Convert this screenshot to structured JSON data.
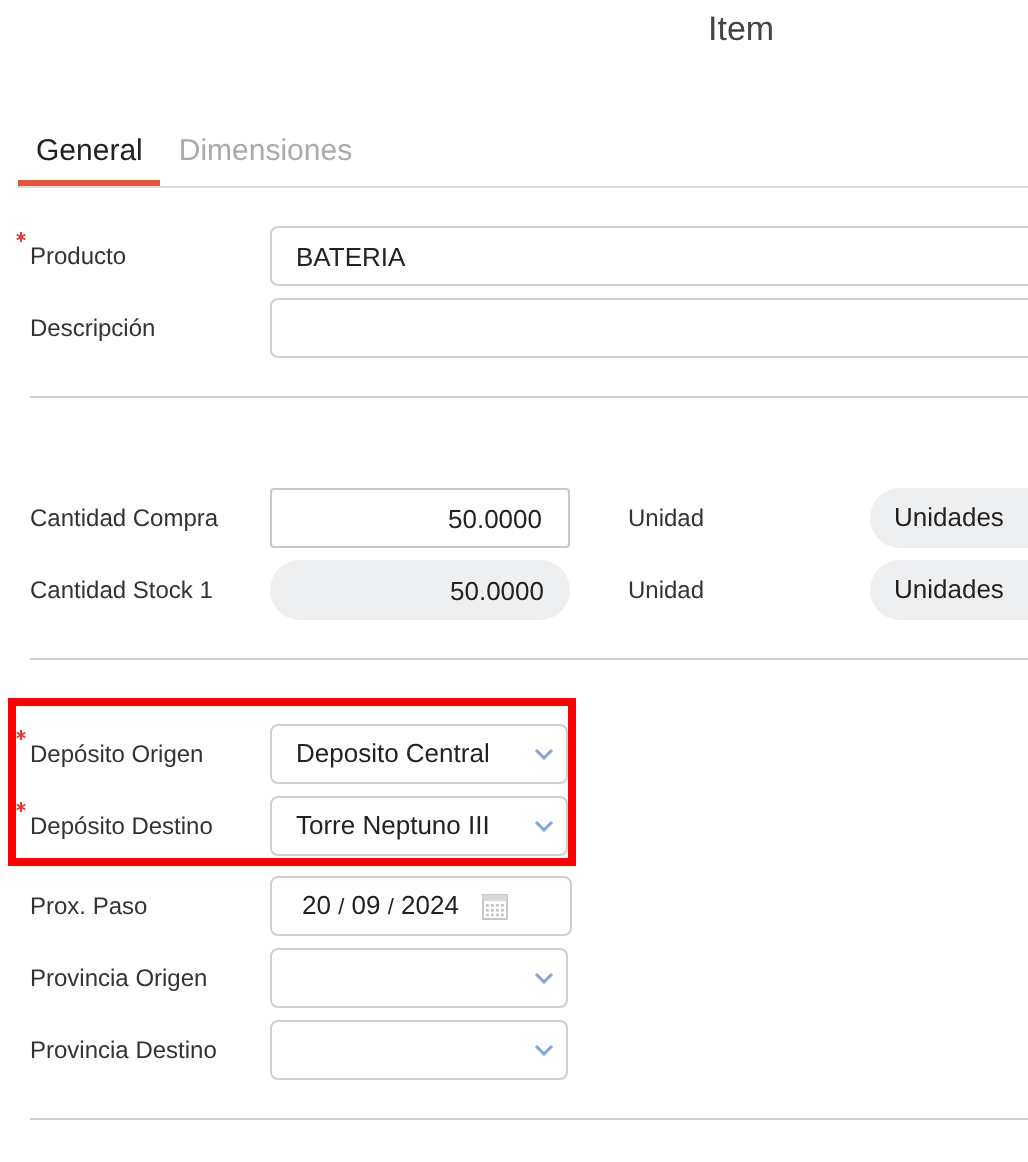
{
  "title": "Item",
  "tabs": [
    {
      "label": "General",
      "selected": true
    },
    {
      "label": "Dimensiones",
      "selected": false
    }
  ],
  "sections": [
    {
      "rows": [
        {
          "kind": "text",
          "label": "Producto",
          "required": true,
          "value": "BATERIA"
        },
        {
          "kind": "text",
          "label": "Descripción",
          "required": false
        }
      ]
    },
    {
      "rows": [
        {
          "kind": "quantity",
          "label": "Cantidad Compra",
          "required": false,
          "value": "50.0000",
          "readonly": false,
          "unit_label": "Unidad",
          "unit": "Unidades"
        },
        {
          "kind": "quantity",
          "label": "Cantidad Stock 1",
          "required": false,
          "value": "50.0000",
          "readonly": true,
          "unit_label": "Unidad",
          "unit": "Unidades"
        }
      ]
    },
    {
      "rows": [
        {
          "kind": "select",
          "label": "Depósito Origen",
          "required": true,
          "highlighted": true,
          "value": "Deposito Central"
        },
        {
          "kind": "select",
          "label": "Depósito Destino",
          "required": true,
          "highlighted": true,
          "value": "Torre Neptuno III"
        },
        {
          "kind": "date",
          "label": "Prox. Paso",
          "required": false,
          "highlighted": false,
          "day": "20",
          "month": "09",
          "year": "2024",
          "separator": "/"
        },
        {
          "kind": "select",
          "label": "Provincia Origen",
          "required": false,
          "highlighted": false
        },
        {
          "kind": "select",
          "label": "Provincia Destino",
          "required": false,
          "highlighted": false
        }
      ]
    }
  ]
}
